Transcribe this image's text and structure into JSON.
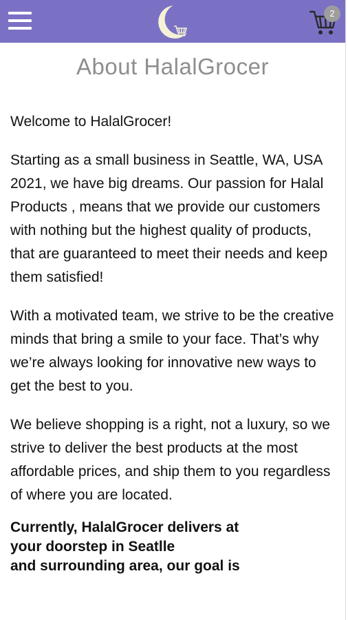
{
  "header": {
    "menu_icon": "hamburger-menu-icon",
    "logo_icon": "crescent-moon-cart-logo",
    "cart_icon": "shopping-cart-icon",
    "cart_count": "2",
    "bar_color": "#7b71c4"
  },
  "page": {
    "title": "About HalalGrocer",
    "paragraphs": [
      "Welcome to HalalGrocer!",
      "Starting as a small business in Seattle, WA, USA 2021, we have big dreams. Our passion for Halal Products , means that we provide our customers with nothing but the highest quality of products, that are guaranteed to meet their needs and keep them satisfied!",
      "With a motivated team, we strive to be the creative minds that bring a smile to your face. That’s why we’re always looking for innovative new ways to get the best to you.",
      "We believe shopping is a right, not a luxury, so we strive to deliver the best products at the most affordable prices, and ship them to you regardless of where you are located."
    ],
    "bold_lines": [
      "Currently, HalalGrocer delivers at",
      "your doorstep in Seatlle",
      "and surrounding area, our goal is"
    ]
  }
}
